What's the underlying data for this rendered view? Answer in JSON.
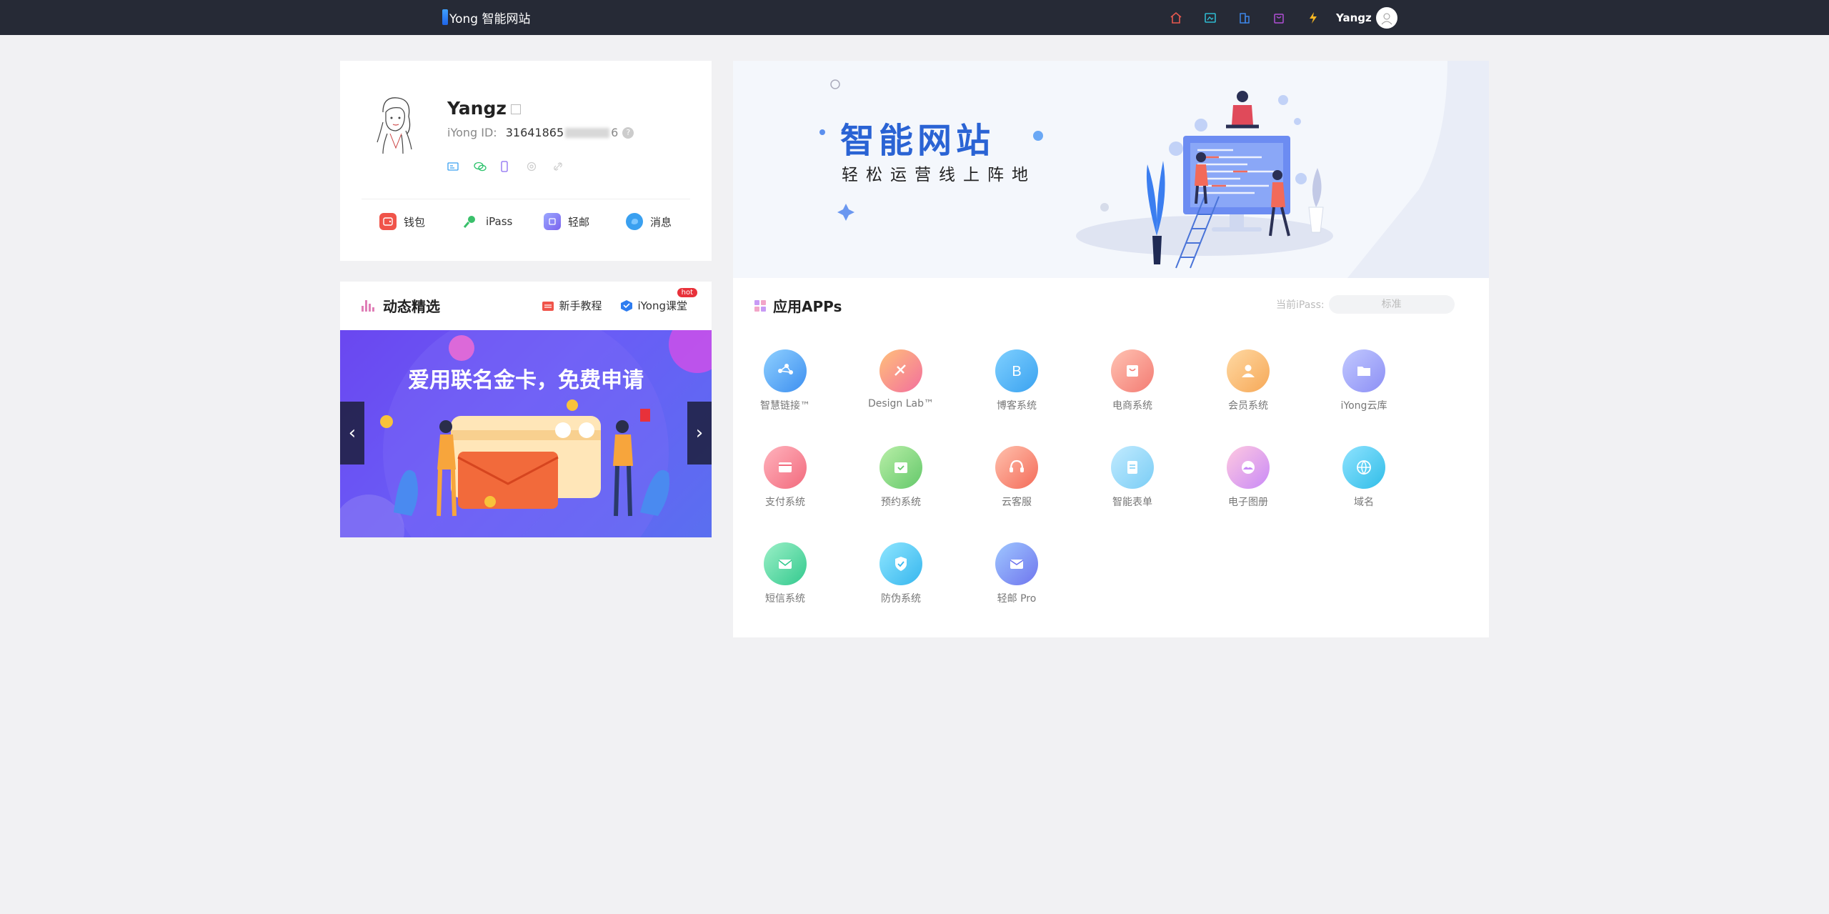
{
  "topbar": {
    "logo_text": "Yong 智能网站",
    "user_name": "Yangz",
    "nav_icons": [
      "home-icon",
      "gallery-icon",
      "building-icon",
      "bag-icon",
      "lightning-icon"
    ]
  },
  "profile": {
    "name": "Yangz",
    "id_label": "iYong ID:",
    "id_prefix": "31641865",
    "id_suffix": "6",
    "bind_icons": [
      "id-card-icon",
      "wechat-icon",
      "phone-icon",
      "email-icon",
      "link-icon"
    ],
    "actions": [
      {
        "label": "钱包",
        "icon": "wallet-icon",
        "color": "#f0544a"
      },
      {
        "label": "iPass",
        "icon": "key-icon",
        "color": "#3ac06b"
      },
      {
        "label": "轻邮",
        "icon": "mail-icon",
        "color": "#8a7cf4"
      },
      {
        "label": "消息",
        "icon": "message-icon",
        "color": "#3aa0f0"
      }
    ]
  },
  "news": {
    "title": "动态精选",
    "links": [
      {
        "label": "新手教程",
        "icon": "tutorial-icon"
      },
      {
        "label": "iYong课堂",
        "icon": "classroom-icon",
        "badge": "hot"
      }
    ],
    "banner_text": "爱用联名金卡，免费申请"
  },
  "hero": {
    "title": "智能网站",
    "subtitle": "轻松运营线上阵地"
  },
  "apps": {
    "title": "应用APPs",
    "ipass_label": "当前iPass:",
    "ipass_value": "标准",
    "items": [
      {
        "label": "智慧链接™",
        "icon": "smart-link-icon",
        "c1": "#8fd0ff",
        "c2": "#3d8ff0"
      },
      {
        "label": "Design Lab™",
        "icon": "design-lab-icon",
        "c1": "#ffc07a",
        "c2": "#f36f9d"
      },
      {
        "label": "博客系统",
        "icon": "blog-icon",
        "c1": "#7fd0ff",
        "c2": "#3aa2f0"
      },
      {
        "label": "电商系统",
        "icon": "shop-icon",
        "c1": "#ffc3b3",
        "c2": "#f37b73"
      },
      {
        "label": "会员系统",
        "icon": "member-icon",
        "c1": "#ffd9a3",
        "c2": "#f6a857"
      },
      {
        "label": "iYong云库",
        "icon": "cloud-folder-icon",
        "c1": "#c2c9ff",
        "c2": "#8c8ff5"
      },
      {
        "label": "支付系统",
        "icon": "payment-icon",
        "c1": "#ffb3bd",
        "c2": "#f26a7d"
      },
      {
        "label": "预约系统",
        "icon": "booking-icon",
        "c1": "#b9efa8",
        "c2": "#64c86a"
      },
      {
        "label": "云客服",
        "icon": "customer-service-icon",
        "c1": "#ffc1ad",
        "c2": "#f46b59"
      },
      {
        "label": "智能表单",
        "icon": "form-icon",
        "c1": "#c2ebff",
        "c2": "#7acdf5"
      },
      {
        "label": "电子图册",
        "icon": "album-icon",
        "c1": "#ffc9e0",
        "c2": "#c98af7"
      },
      {
        "label": "域名",
        "icon": "domain-icon",
        "c1": "#8fe3ff",
        "c2": "#30bde8"
      },
      {
        "label": "短信系统",
        "icon": "sms-icon",
        "c1": "#9bf0c7",
        "c2": "#33c98e"
      },
      {
        "label": "防伪系统",
        "icon": "shield-icon",
        "c1": "#8fe6ff",
        "c2": "#36b6ee"
      },
      {
        "label": "轻邮 Pro",
        "icon": "mail-pro-icon",
        "c1": "#9fc7ff",
        "c2": "#6f75ee"
      }
    ]
  }
}
